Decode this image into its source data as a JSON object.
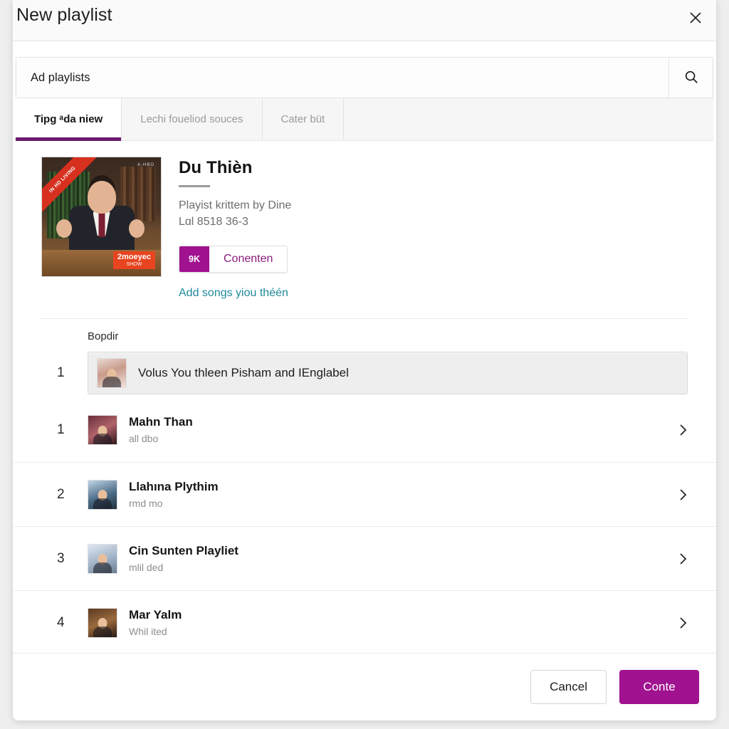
{
  "dialog": {
    "title": "New playlist",
    "close_icon": "close-icon"
  },
  "search": {
    "value": "Ad playlists",
    "placeholder": "Ad playlists",
    "icon": "search-icon"
  },
  "tabs": [
    {
      "label": "Tipg ᵃda niew",
      "active": true
    },
    {
      "label": "Lechi foueliod souces",
      "active": false
    },
    {
      "label": "Cater büt",
      "active": false
    }
  ],
  "playlist": {
    "title": "Du Thièn",
    "meta_author": "Playist krittem by Dine",
    "meta_stats": "Lɑl 8518 36-3",
    "badge_count": "9K",
    "badge_label": "Conenten",
    "add_songs_link": "Add songs yiou théén",
    "cover_banner": "IN HD LIVING",
    "cover_logo": "2moeyec",
    "cover_logo_sub": "SHOW",
    "cover_tvlogo": "A-HBO"
  },
  "list": {
    "section_label": "Bopdir",
    "highlighted": {
      "index": "1",
      "title": "Volus You thleen Pisham and IEnglabel"
    },
    "rows": [
      {
        "index": "1",
        "title": "Mahn Than",
        "subtitle": "all dbo",
        "chevron": "chevron-right-icon"
      },
      {
        "index": "2",
        "title": "Llahına Plythim",
        "subtitle": "rmd mo",
        "chevron": "chevron-right-icon"
      },
      {
        "index": "3",
        "title": "Cin Sunten Playliet",
        "subtitle": "mlil ded",
        "chevron": "chevron-right-icon"
      },
      {
        "index": "4",
        "title": "Mar Yalm",
        "subtitle": "Whil ited",
        "chevron": "chevron-right-icon"
      }
    ]
  },
  "footer": {
    "cancel_label": "Cancel",
    "confirm_label": "Conte"
  },
  "colors": {
    "accent_purple": "#a0128f",
    "tab_underline": "#6a1a6e",
    "link_teal": "#1f8a9b",
    "badge_label_purple": "#8b1b7e"
  }
}
